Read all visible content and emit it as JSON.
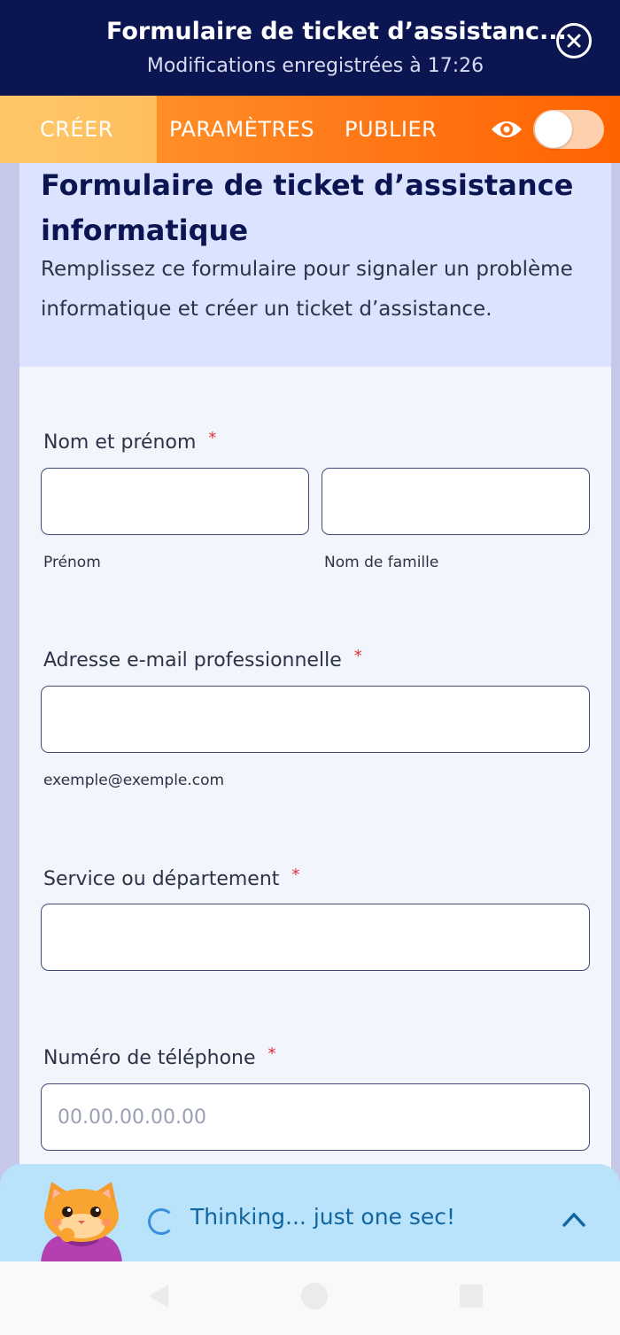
{
  "header": {
    "title": "Formulaire de ticket d’assistanc...",
    "subtitle": "Modifications enregistrées à 17:26"
  },
  "tabs": [
    {
      "label": "CRÉER",
      "active": true
    },
    {
      "label": "PARAMÈTRES",
      "active": false
    },
    {
      "label": "PUBLIER",
      "active": false
    }
  ],
  "preview_toggle": {
    "on": false
  },
  "form": {
    "title": "Formulaire de ticket d’assistance informatique",
    "description": "Remplissez ce formulaire pour signaler un problème informatique et créer un ticket d’assistance.",
    "required_mark": "*",
    "fields": {
      "name": {
        "label": "Nom et prénom",
        "first_sublabel": "Prénom",
        "last_sublabel": "Nom de famille"
      },
      "email": {
        "label": "Adresse e-mail professionnelle",
        "sublabel": "exemple@exemple.com"
      },
      "department": {
        "label": "Service ou département"
      },
      "phone": {
        "label": "Numéro de téléphone",
        "placeholder": "00.00.00.00.00"
      }
    }
  },
  "assistant": {
    "status": "Thinking... just one sec!"
  },
  "colors": {
    "navy": "#0a1551",
    "orange": "#ff7a1a",
    "create_tab": "#ffc766",
    "assistant_bg": "#b8e3fb"
  }
}
